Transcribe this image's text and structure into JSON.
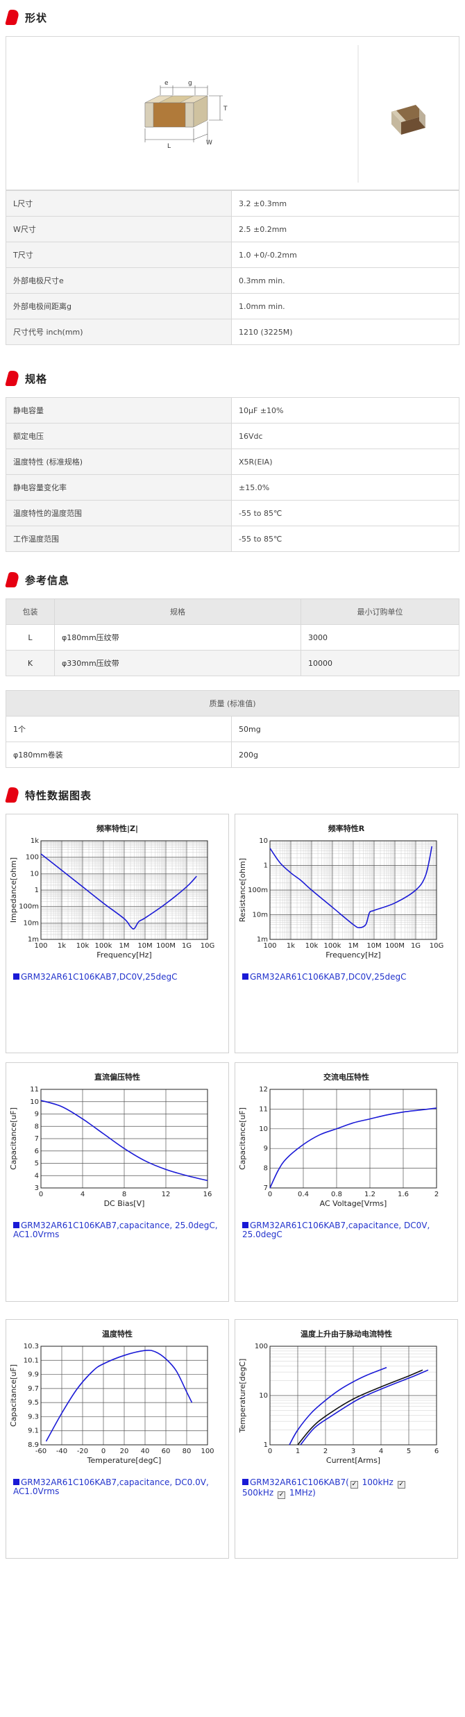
{
  "sections": {
    "shape": "形状",
    "spec": "规格",
    "ref": "参考信息",
    "charts": "特性数据图表"
  },
  "drawing": {
    "e": "e",
    "g": "g",
    "T": "T",
    "L": "L",
    "W": "W"
  },
  "shape_rows": [
    {
      "k": "L尺寸",
      "v": "3.2 ±0.3mm"
    },
    {
      "k": "W尺寸",
      "v": "2.5 ±0.2mm"
    },
    {
      "k": "T尺寸",
      "v": "1.0 +0/-0.2mm"
    },
    {
      "k": "外部电极尺寸e",
      "v": "0.3mm min."
    },
    {
      "k": "外部电极间距离g",
      "v": "1.0mm min."
    },
    {
      "k": "尺寸代号 inch(mm)",
      "v": "1210 (3225M)"
    }
  ],
  "spec_rows": [
    {
      "k": "静电容量",
      "v": "10μF ±10%"
    },
    {
      "k": "额定电压",
      "v": "16Vdc"
    },
    {
      "k": "温度特性 (标准规格)",
      "v": "X5R(EIA)"
    },
    {
      "k": "静电容量变化率",
      "v": "±15.0%"
    },
    {
      "k": "温度特性的温度范围",
      "v": "-55 to 85℃"
    },
    {
      "k": "工作温度范围",
      "v": "-55 to 85℃"
    }
  ],
  "pack_table": {
    "headers": [
      "包装",
      "规格",
      "最小订购单位"
    ],
    "rows": [
      [
        "L",
        "φ180mm压纹带",
        "3000"
      ],
      [
        "K",
        "φ330mm压纹带",
        "10000"
      ]
    ]
  },
  "mass_table": {
    "header": "质量 (标准值)",
    "rows": [
      [
        "1个",
        "50mg"
      ],
      [
        "φ180mm卷装",
        "200g"
      ]
    ]
  },
  "charts": [
    {
      "title": "频率特性|Z|",
      "legend": "GRM32AR61C106KAB7,DC0V,25degC",
      "chart_data": {
        "type": "line",
        "xlabel": "Frequency[Hz]",
        "ylabel": "Impedance[ohm]",
        "x_ticks": [
          "100",
          "1k",
          "10k",
          "100k",
          "1M",
          "10M",
          "100M",
          "1G",
          "10G"
        ],
        "y_ticks": [
          "1m",
          "10m",
          "100m",
          "1",
          "10",
          "100",
          "1k"
        ],
        "x_scale": "log",
        "y_scale": "log",
        "series": [
          {
            "name": "GRM32AR61C106KAB7,DC0V,25degC",
            "x": [
              100,
              1000,
              10000,
              100000,
              1000000,
              2000000,
              3000000,
              5000000,
              10000000,
              100000000,
              1000000000,
              3000000000
            ],
            "values": [
              160,
              16,
              1.6,
              0.16,
              0.018,
              0.006,
              0.0045,
              0.012,
              0.02,
              0.15,
              1.6,
              7
            ]
          }
        ]
      }
    },
    {
      "title": "频率特性R",
      "legend": "GRM32AR61C106KAB7,DC0V,25degC",
      "chart_data": {
        "type": "line",
        "xlabel": "Frequency[Hz]",
        "ylabel": "Resistance[ohm]",
        "x_ticks": [
          "100",
          "1k",
          "10k",
          "100k",
          "1M",
          "10M",
          "100M",
          "1G",
          "10G"
        ],
        "y_ticks": [
          "1m",
          "10m",
          "100m",
          "1",
          "10"
        ],
        "x_scale": "log",
        "y_scale": "log",
        "series": [
          {
            "name": "GRM32AR61C106KAB7,DC0V,25degC",
            "x": [
              100,
              300,
              1000,
              3000,
              10000,
              100000,
              1000000,
              2000000,
              4000000,
              6000000,
              10000000,
              100000000,
              1000000000,
              3000000000,
              6000000000
            ],
            "values": [
              5,
              1.3,
              0.5,
              0.25,
              0.1,
              0.02,
              0.004,
              0.003,
              0.004,
              0.012,
              0.015,
              0.03,
              0.1,
              0.4,
              6
            ]
          }
        ]
      }
    },
    {
      "title": "直流偏压特性",
      "legend": "GRM32AR61C106KAB7,capacitance, 25.0degC, AC1.0Vrms",
      "chart_data": {
        "type": "line",
        "xlabel": "DC Bias[V]",
        "ylabel": "Capacitance[uF]",
        "x_ticks": [
          "0",
          "4",
          "8",
          "12",
          "16"
        ],
        "y_ticks": [
          "3",
          "4",
          "5",
          "6",
          "7",
          "8",
          "9",
          "10",
          "11"
        ],
        "xlim": [
          0,
          16
        ],
        "ylim": [
          3,
          11
        ],
        "series": [
          {
            "name": "GRM32AR61C106KAB7,capacitance, 25.0degC, AC1.0Vrms",
            "x": [
              0,
              2,
              4,
              6,
              8,
              10,
              12,
              14,
              16
            ],
            "values": [
              10.1,
              9.6,
              8.6,
              7.4,
              6.2,
              5.2,
              4.5,
              4.0,
              3.6
            ]
          }
        ]
      }
    },
    {
      "title": "交流电压特性",
      "legend": "GRM32AR61C106KAB7,capacitance, DC0V, 25.0degC",
      "chart_data": {
        "type": "line",
        "xlabel": "AC Voltage[Vrms]",
        "ylabel": "Capacitance[uF]",
        "x_ticks": [
          "0",
          "0.4",
          "0.8",
          "1.2",
          "1.6",
          "2"
        ],
        "y_ticks": [
          "7",
          "8",
          "9",
          "10",
          "11",
          "12"
        ],
        "xlim": [
          0,
          2
        ],
        "ylim": [
          7,
          12
        ],
        "series": [
          {
            "name": "GRM32AR61C106KAB7,capacitance, DC0V, 25.0degC",
            "x": [
              0,
              0.1,
              0.2,
              0.4,
              0.6,
              0.8,
              1.0,
              1.2,
              1.4,
              1.6,
              1.8,
              2.0
            ],
            "values": [
              7.0,
              7.9,
              8.5,
              9.2,
              9.7,
              10.0,
              10.3,
              10.5,
              10.7,
              10.85,
              10.95,
              11.05
            ]
          }
        ]
      }
    },
    {
      "title": "温度特性",
      "legend": "GRM32AR61C106KAB7,capacitance, DC0.0V, AC1.0Vrms",
      "chart_data": {
        "type": "line",
        "xlabel": "Temperature[degC]",
        "ylabel": "Capacitance[uF]",
        "x_ticks": [
          "-60",
          "-40",
          "-20",
          "0",
          "20",
          "40",
          "60",
          "80",
          "100"
        ],
        "y_ticks": [
          "8.9",
          "9.1",
          "9.3",
          "9.5",
          "9.7",
          "9.9",
          "10.1",
          "10.3"
        ],
        "xlim": [
          -60,
          100
        ],
        "ylim": [
          8.9,
          10.3
        ],
        "series": [
          {
            "name": "GRM32AR61C106KAB7,capacitance, DC0.0V, AC1.0Vrms",
            "x": [
              -55,
              -40,
              -25,
              -10,
              0,
              20,
              40,
              50,
              60,
              70,
              80,
              85
            ],
            "values": [
              8.95,
              9.35,
              9.7,
              9.95,
              10.05,
              10.17,
              10.24,
              10.22,
              10.12,
              9.95,
              9.65,
              9.5
            ]
          }
        ]
      }
    },
    {
      "title": "温度上升由于脉动电流特性",
      "legend_parts": [
        "GRM32AR61C106KAB7(",
        " 100kHz ",
        " 500kHz ",
        " 1MHz)"
      ],
      "chart_data": {
        "type": "line",
        "xlabel": "Current[Arms]",
        "ylabel": "Temperature[degC]",
        "x_ticks": [
          "0",
          "1",
          "2",
          "3",
          "4",
          "5",
          "6"
        ],
        "y_ticks": [
          "1",
          "10",
          "100"
        ],
        "xlim": [
          0,
          6
        ],
        "y_scale": "log",
        "series": [
          {
            "name": "100kHz",
            "x": [
              0.7,
              1.0,
              1.5,
              2.0,
              2.5,
              3.0,
              3.5,
              4.2
            ],
            "values": [
              1,
              2,
              4.5,
              8,
              13,
              19,
              26,
              37
            ]
          },
          {
            "name": "500kHz",
            "x": [
              1.0,
              1.5,
              2.0,
              3.0,
              4.0,
              5.0,
              5.5
            ],
            "values": [
              1,
              2.2,
              3.8,
              8.5,
              15,
              25,
              33
            ]
          },
          {
            "name": "1MHz",
            "x": [
              1.1,
              1.6,
              2.2,
              3.2,
              4.2,
              5.2,
              5.7
            ],
            "values": [
              1,
              2.2,
              3.8,
              8.5,
              15,
              25,
              33
            ]
          }
        ]
      }
    }
  ]
}
